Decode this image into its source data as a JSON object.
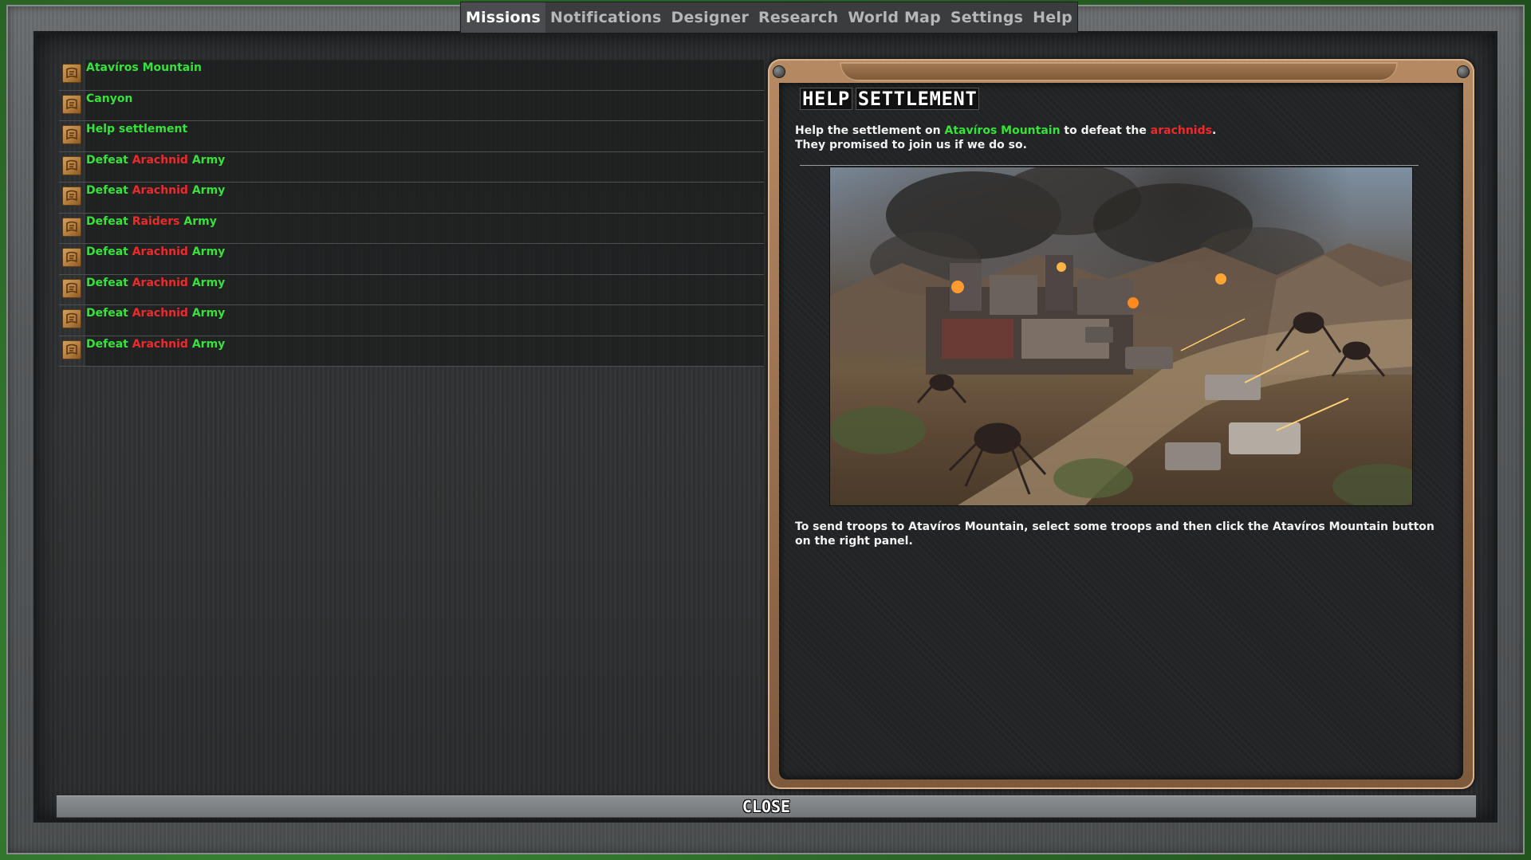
{
  "tabs": [
    {
      "label": "Missions",
      "active": true
    },
    {
      "label": "Notifications",
      "active": false
    },
    {
      "label": "Designer",
      "active": false
    },
    {
      "label": "Research",
      "active": false
    },
    {
      "label": "World Map",
      "active": false
    },
    {
      "label": "Settings",
      "active": false
    },
    {
      "label": "Help",
      "active": false
    }
  ],
  "missions": [
    {
      "icon": "scroll-icon",
      "parts": [
        {
          "text": "Atavíros Mountain",
          "color": "green"
        }
      ]
    },
    {
      "icon": "scroll-icon",
      "parts": [
        {
          "text": "Canyon",
          "color": "green"
        }
      ]
    },
    {
      "icon": "scroll-icon",
      "parts": [
        {
          "text": "Help settlement",
          "color": "green"
        }
      ]
    },
    {
      "icon": "scroll-icon",
      "parts": [
        {
          "text": "Defeat ",
          "color": "green"
        },
        {
          "text": "Arachnid",
          "color": "red"
        },
        {
          "text": " Army",
          "color": "green"
        }
      ]
    },
    {
      "icon": "scroll-icon",
      "parts": [
        {
          "text": "Defeat ",
          "color": "green"
        },
        {
          "text": "Arachnid",
          "color": "red"
        },
        {
          "text": " Army",
          "color": "green"
        }
      ]
    },
    {
      "icon": "scroll-icon",
      "parts": [
        {
          "text": "Defeat ",
          "color": "green"
        },
        {
          "text": "Raiders",
          "color": "red"
        },
        {
          "text": " Army",
          "color": "green"
        }
      ]
    },
    {
      "icon": "scroll-icon",
      "parts": [
        {
          "text": "Defeat ",
          "color": "green"
        },
        {
          "text": "Arachnid",
          "color": "red"
        },
        {
          "text": " Army",
          "color": "green"
        }
      ]
    },
    {
      "icon": "scroll-icon",
      "parts": [
        {
          "text": "Defeat ",
          "color": "green"
        },
        {
          "text": "Arachnid",
          "color": "red"
        },
        {
          "text": " Army",
          "color": "green"
        }
      ]
    },
    {
      "icon": "scroll-icon",
      "parts": [
        {
          "text": "Defeat ",
          "color": "green"
        },
        {
          "text": "Arachnid",
          "color": "red"
        },
        {
          "text": " Army",
          "color": "green"
        }
      ]
    },
    {
      "icon": "scroll-icon",
      "parts": [
        {
          "text": "Defeat ",
          "color": "green"
        },
        {
          "text": "Arachnid",
          "color": "red"
        },
        {
          "text": " Army",
          "color": "green"
        }
      ]
    }
  ],
  "detail": {
    "title_words": [
      "HELP",
      "SETTLEMENT"
    ],
    "description_line1": {
      "pre": "Help the settlement on ",
      "location": "Atavíros Mountain",
      "mid": " to defeat the ",
      "enemy": "arachnids",
      "post": "."
    },
    "description_line2": "They promised to join us if we do so.",
    "instructions": "To send troops to Atavíros Mountain, select some troops and then click the Atavíros Mountain button on the right panel.",
    "artwork": "battle-scene-image"
  },
  "close_label": "CLOSE",
  "colors": {
    "green_text": "#37e23a",
    "red_text": "#ee2a2a",
    "panel_frame": "#9a7150",
    "panel_bg": "#222425"
  }
}
